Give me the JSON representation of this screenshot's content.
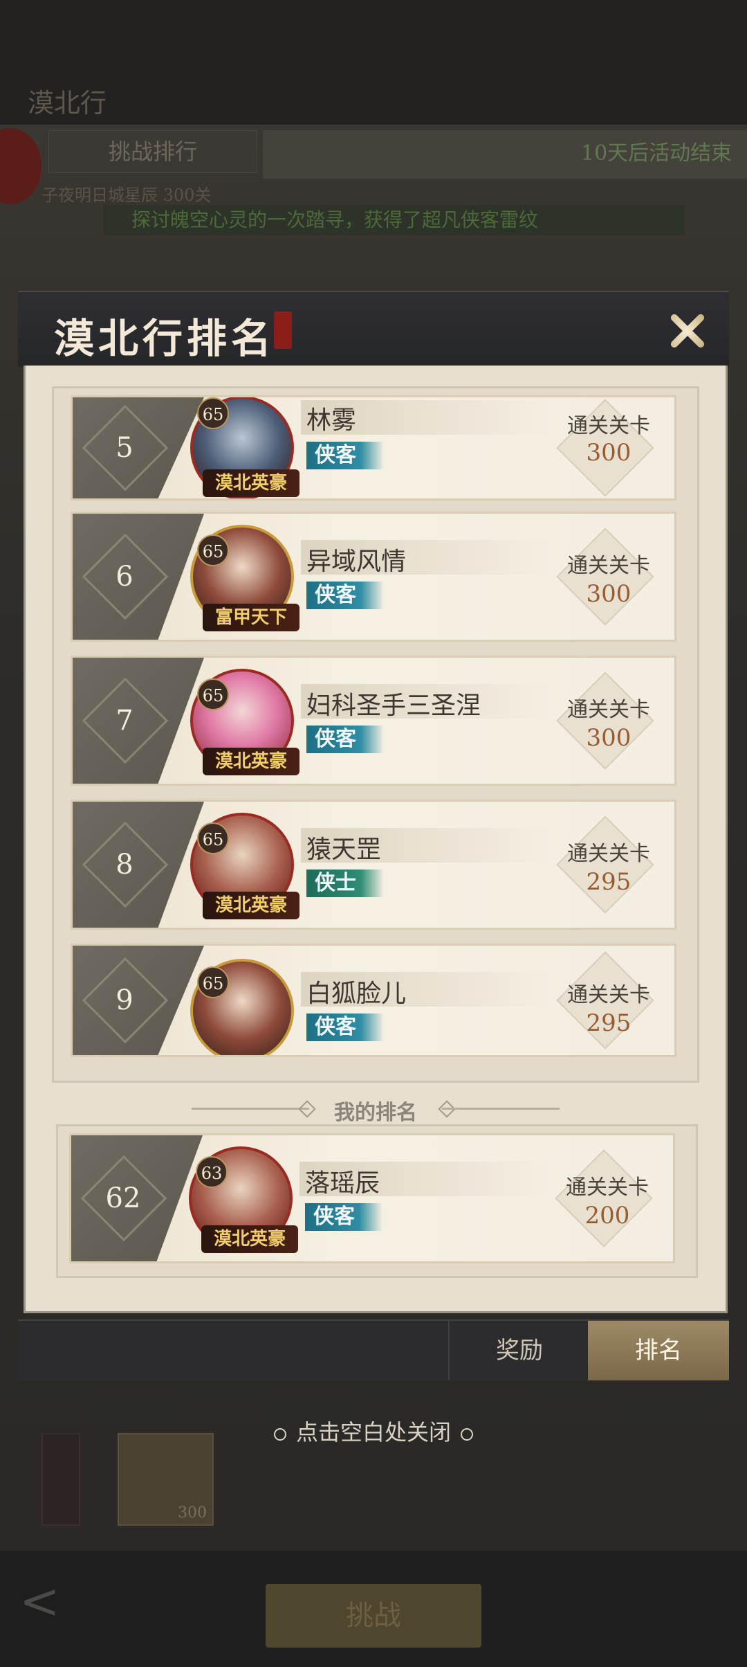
{
  "background": {
    "title": "漠北行",
    "subtab": "挑战排行",
    "countdown": "10天后活动结束",
    "line1": "子夜明日城星辰    300关",
    "notice": "探讨魄空心灵的一次踏寻，获得了超凡侠客雷纹",
    "item_count": "300",
    "challenge_button": "挑战"
  },
  "modal": {
    "title": "漠北行排名",
    "rows": [
      {
        "rank": "5",
        "level": "65",
        "badge": "漠北英豪",
        "name": "林雾",
        "class": "侠客",
        "pass_label": "通关关卡",
        "pass_value": "300"
      },
      {
        "rank": "6",
        "level": "65",
        "badge": "富甲天下",
        "name": "异域风情",
        "class": "侠客",
        "pass_label": "通关关卡",
        "pass_value": "300"
      },
      {
        "rank": "7",
        "level": "65",
        "badge": "漠北英豪",
        "name": "妇科圣手三圣涅",
        "class": "侠客",
        "pass_label": "通关关卡",
        "pass_value": "300"
      },
      {
        "rank": "8",
        "level": "65",
        "badge": "漠北英豪",
        "name": "猿天罡",
        "class": "侠士",
        "pass_label": "通关关卡",
        "pass_value": "295"
      },
      {
        "rank": "9",
        "level": "65",
        "badge": "",
        "name": "白狐脸儿",
        "class": "侠客",
        "pass_label": "通关关卡",
        "pass_value": "295"
      }
    ],
    "my_rank_title": "我的排名",
    "my_row": {
      "rank": "62",
      "level": "63",
      "badge": "漠北英豪",
      "name": "落瑶辰",
      "class": "侠客",
      "pass_label": "通关关卡",
      "pass_value": "200"
    }
  },
  "tabs": {
    "reward": "奖励",
    "rank": "排名"
  },
  "hint": "点击空白处关闭",
  "colors": {
    "accent_gold": "#9e8a66",
    "value_brown": "#9a5b2e",
    "class_blue": "#2f8da3"
  }
}
